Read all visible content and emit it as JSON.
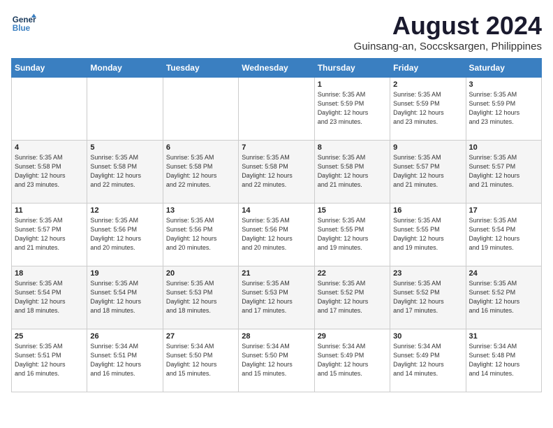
{
  "header": {
    "logo_line1": "General",
    "logo_line2": "Blue",
    "month_year": "August 2024",
    "location": "Guinsang-an, Soccsksargen, Philippines"
  },
  "weekdays": [
    "Sunday",
    "Monday",
    "Tuesday",
    "Wednesday",
    "Thursday",
    "Friday",
    "Saturday"
  ],
  "weeks": [
    [
      {
        "num": "",
        "info": ""
      },
      {
        "num": "",
        "info": ""
      },
      {
        "num": "",
        "info": ""
      },
      {
        "num": "",
        "info": ""
      },
      {
        "num": "1",
        "info": "Sunrise: 5:35 AM\nSunset: 5:59 PM\nDaylight: 12 hours\nand 23 minutes."
      },
      {
        "num": "2",
        "info": "Sunrise: 5:35 AM\nSunset: 5:59 PM\nDaylight: 12 hours\nand 23 minutes."
      },
      {
        "num": "3",
        "info": "Sunrise: 5:35 AM\nSunset: 5:59 PM\nDaylight: 12 hours\nand 23 minutes."
      }
    ],
    [
      {
        "num": "4",
        "info": "Sunrise: 5:35 AM\nSunset: 5:58 PM\nDaylight: 12 hours\nand 23 minutes."
      },
      {
        "num": "5",
        "info": "Sunrise: 5:35 AM\nSunset: 5:58 PM\nDaylight: 12 hours\nand 22 minutes."
      },
      {
        "num": "6",
        "info": "Sunrise: 5:35 AM\nSunset: 5:58 PM\nDaylight: 12 hours\nand 22 minutes."
      },
      {
        "num": "7",
        "info": "Sunrise: 5:35 AM\nSunset: 5:58 PM\nDaylight: 12 hours\nand 22 minutes."
      },
      {
        "num": "8",
        "info": "Sunrise: 5:35 AM\nSunset: 5:58 PM\nDaylight: 12 hours\nand 21 minutes."
      },
      {
        "num": "9",
        "info": "Sunrise: 5:35 AM\nSunset: 5:57 PM\nDaylight: 12 hours\nand 21 minutes."
      },
      {
        "num": "10",
        "info": "Sunrise: 5:35 AM\nSunset: 5:57 PM\nDaylight: 12 hours\nand 21 minutes."
      }
    ],
    [
      {
        "num": "11",
        "info": "Sunrise: 5:35 AM\nSunset: 5:57 PM\nDaylight: 12 hours\nand 21 minutes."
      },
      {
        "num": "12",
        "info": "Sunrise: 5:35 AM\nSunset: 5:56 PM\nDaylight: 12 hours\nand 20 minutes."
      },
      {
        "num": "13",
        "info": "Sunrise: 5:35 AM\nSunset: 5:56 PM\nDaylight: 12 hours\nand 20 minutes."
      },
      {
        "num": "14",
        "info": "Sunrise: 5:35 AM\nSunset: 5:56 PM\nDaylight: 12 hours\nand 20 minutes."
      },
      {
        "num": "15",
        "info": "Sunrise: 5:35 AM\nSunset: 5:55 PM\nDaylight: 12 hours\nand 19 minutes."
      },
      {
        "num": "16",
        "info": "Sunrise: 5:35 AM\nSunset: 5:55 PM\nDaylight: 12 hours\nand 19 minutes."
      },
      {
        "num": "17",
        "info": "Sunrise: 5:35 AM\nSunset: 5:54 PM\nDaylight: 12 hours\nand 19 minutes."
      }
    ],
    [
      {
        "num": "18",
        "info": "Sunrise: 5:35 AM\nSunset: 5:54 PM\nDaylight: 12 hours\nand 18 minutes."
      },
      {
        "num": "19",
        "info": "Sunrise: 5:35 AM\nSunset: 5:54 PM\nDaylight: 12 hours\nand 18 minutes."
      },
      {
        "num": "20",
        "info": "Sunrise: 5:35 AM\nSunset: 5:53 PM\nDaylight: 12 hours\nand 18 minutes."
      },
      {
        "num": "21",
        "info": "Sunrise: 5:35 AM\nSunset: 5:53 PM\nDaylight: 12 hours\nand 17 minutes."
      },
      {
        "num": "22",
        "info": "Sunrise: 5:35 AM\nSunset: 5:52 PM\nDaylight: 12 hours\nand 17 minutes."
      },
      {
        "num": "23",
        "info": "Sunrise: 5:35 AM\nSunset: 5:52 PM\nDaylight: 12 hours\nand 17 minutes."
      },
      {
        "num": "24",
        "info": "Sunrise: 5:35 AM\nSunset: 5:52 PM\nDaylight: 12 hours\nand 16 minutes."
      }
    ],
    [
      {
        "num": "25",
        "info": "Sunrise: 5:35 AM\nSunset: 5:51 PM\nDaylight: 12 hours\nand 16 minutes."
      },
      {
        "num": "26",
        "info": "Sunrise: 5:34 AM\nSunset: 5:51 PM\nDaylight: 12 hours\nand 16 minutes."
      },
      {
        "num": "27",
        "info": "Sunrise: 5:34 AM\nSunset: 5:50 PM\nDaylight: 12 hours\nand 15 minutes."
      },
      {
        "num": "28",
        "info": "Sunrise: 5:34 AM\nSunset: 5:50 PM\nDaylight: 12 hours\nand 15 minutes."
      },
      {
        "num": "29",
        "info": "Sunrise: 5:34 AM\nSunset: 5:49 PM\nDaylight: 12 hours\nand 15 minutes."
      },
      {
        "num": "30",
        "info": "Sunrise: 5:34 AM\nSunset: 5:49 PM\nDaylight: 12 hours\nand 14 minutes."
      },
      {
        "num": "31",
        "info": "Sunrise: 5:34 AM\nSunset: 5:48 PM\nDaylight: 12 hours\nand 14 minutes."
      }
    ]
  ]
}
